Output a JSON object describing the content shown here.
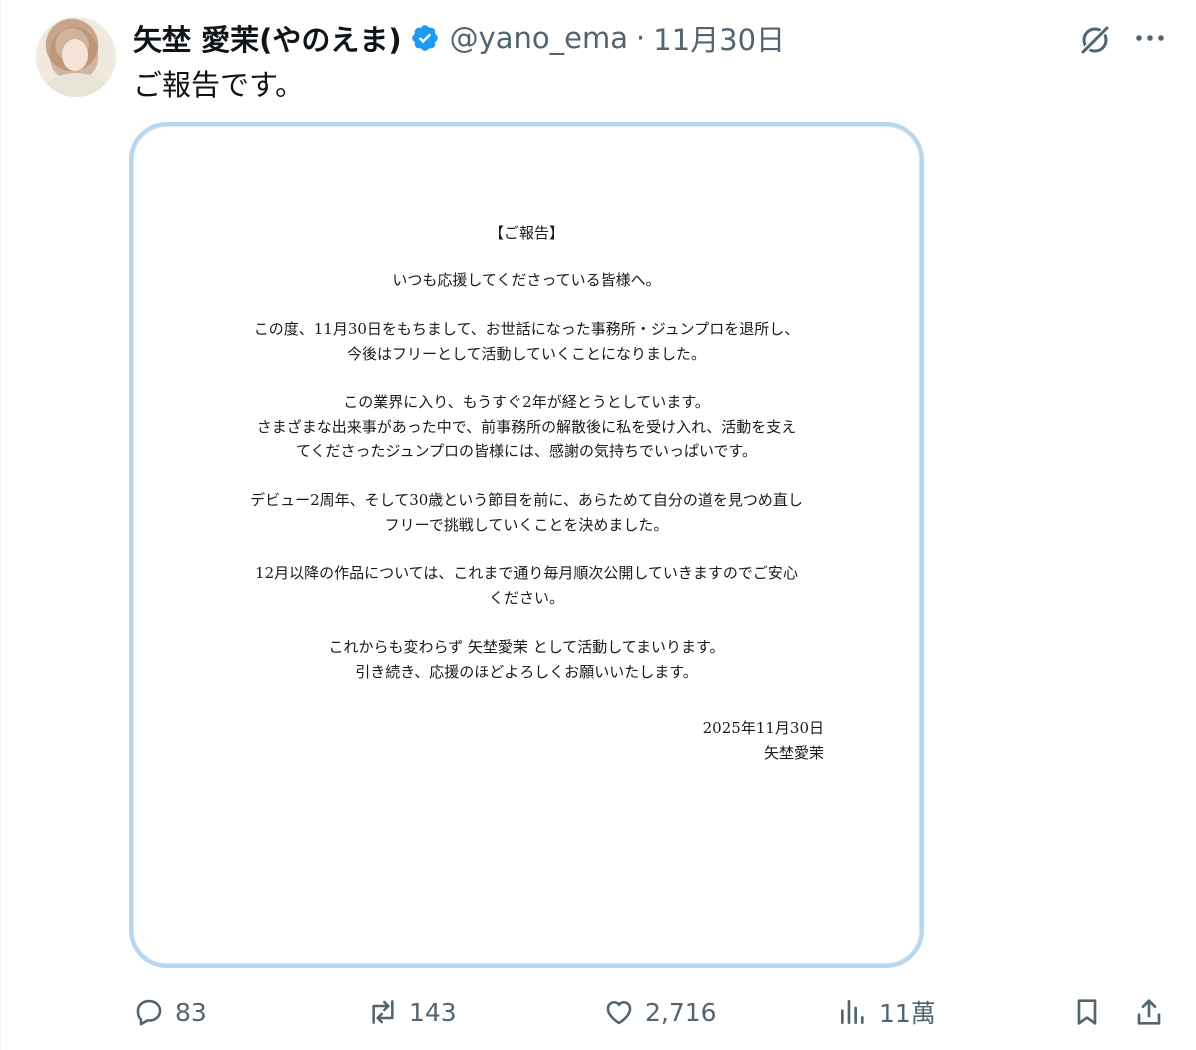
{
  "author": {
    "display_name": "矢埜 愛茉(やのえま)",
    "handle": "@yano_ema",
    "separator": "·",
    "date": "11月30日"
  },
  "tweet": {
    "text": "ご報告です。"
  },
  "letter": {
    "title": "【ご報告】",
    "greeting": "いつも応援してくださっている皆様へ。",
    "para1": [
      "この度、11月30日をもちまして、お世話になった事務所・ジュンプロを退所し、",
      "今後はフリーとして活動していくことになりました。"
    ],
    "para2": [
      "この業界に入り、もうすぐ2年が経とうとしています。",
      "さまざまな出来事があった中で、前事務所の解散後に私を受け入れ、活動を支え",
      "てくださったジュンプロの皆様には、感謝の気持ちでいっぱいです。"
    ],
    "para3": [
      "デビュー2周年、そして30歳という節目を前に、あらためて自分の道を見つめ直し",
      "フリーで挑戦していくことを決めました。"
    ],
    "para4": [
      "12月以降の作品については、これまで通り毎月順次公開していきますのでご安心",
      "ください。"
    ],
    "para5": [
      "これからも変わらず 矢埜愛茉 として活動してまいります。",
      "引き続き、応援のほどよろしくお願いいたします。"
    ],
    "sign_date": "2025年11月30日",
    "sign_name": "矢埜愛茉"
  },
  "actions": {
    "replies": "83",
    "retweets": "143",
    "likes": "2,716",
    "views": "11萬"
  },
  "colors": {
    "verified": "#1d9bf0",
    "muted": "#536471",
    "media_border": "#b9d6ef"
  }
}
